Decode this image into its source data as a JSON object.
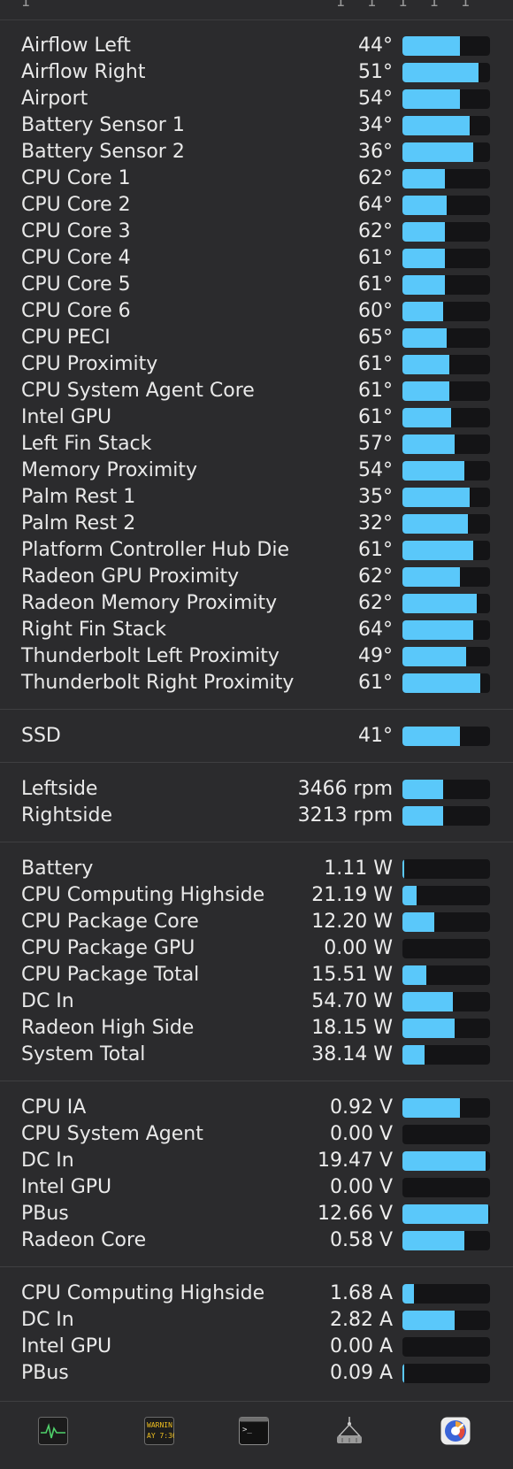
{
  "top": {
    "left_text": "1",
    "right_text": "1  1  1  1  1"
  },
  "temperatures": [
    {
      "name": "Airflow Left",
      "value": "44°",
      "level": 0.66
    },
    {
      "name": "Airflow Right",
      "value": "51°",
      "level": 0.87
    },
    {
      "name": "Airport",
      "value": "54°",
      "level": 0.66
    },
    {
      "name": "Battery Sensor 1",
      "value": "34°",
      "level": 0.77
    },
    {
      "name": "Battery Sensor 2",
      "value": "36°",
      "level": 0.81
    },
    {
      "name": "CPU Core 1",
      "value": "62°",
      "level": 0.48
    },
    {
      "name": "CPU Core 2",
      "value": "64°",
      "level": 0.5
    },
    {
      "name": "CPU Core 3",
      "value": "62°",
      "level": 0.48
    },
    {
      "name": "CPU Core 4",
      "value": "61°",
      "level": 0.48
    },
    {
      "name": "CPU Core 5",
      "value": "61°",
      "level": 0.48
    },
    {
      "name": "CPU Core 6",
      "value": "60°",
      "level": 0.46
    },
    {
      "name": "CPU PECI",
      "value": "65°",
      "level": 0.5
    },
    {
      "name": "CPU Proximity",
      "value": "61°",
      "level": 0.54
    },
    {
      "name": "CPU System Agent Core",
      "value": "61°",
      "level": 0.54
    },
    {
      "name": "Intel GPU",
      "value": "61°",
      "level": 0.56
    },
    {
      "name": "Left Fin Stack",
      "value": "57°",
      "level": 0.6
    },
    {
      "name": "Memory Proximity",
      "value": "54°",
      "level": 0.71
    },
    {
      "name": "Palm Rest 1",
      "value": "35°",
      "level": 0.77
    },
    {
      "name": "Palm Rest 2",
      "value": "32°",
      "level": 0.75
    },
    {
      "name": "Platform Controller Hub Die",
      "value": "61°",
      "level": 0.81
    },
    {
      "name": "Radeon GPU Proximity",
      "value": "62°",
      "level": 0.66
    },
    {
      "name": "Radeon Memory Proximity",
      "value": "62°",
      "level": 0.85
    },
    {
      "name": "Right Fin Stack",
      "value": "64°",
      "level": 0.81
    },
    {
      "name": "Thunderbolt Left Proximity",
      "value": "49°",
      "level": 0.73
    },
    {
      "name": "Thunderbolt Right Proximity",
      "value": "61°",
      "level": 0.89
    }
  ],
  "disks": [
    {
      "name": "SSD",
      "value": "41°",
      "level": 0.66
    }
  ],
  "fans": [
    {
      "name": "Leftside",
      "value": "3466 rpm",
      "level": 0.46
    },
    {
      "name": "Rightside",
      "value": "3213 rpm",
      "level": 0.46
    }
  ],
  "power": [
    {
      "name": "Battery",
      "value": "1.11 W",
      "level": 0.02
    },
    {
      "name": "CPU Computing Highside",
      "value": "21.19 W",
      "level": 0.16
    },
    {
      "name": "CPU Package Core",
      "value": "12.20 W",
      "level": 0.36
    },
    {
      "name": "CPU Package GPU",
      "value": "0.00 W",
      "level": 0.0
    },
    {
      "name": "CPU Package Total",
      "value": "15.51 W",
      "level": 0.27
    },
    {
      "name": "DC In",
      "value": "54.70 W",
      "level": 0.58
    },
    {
      "name": "Radeon High Side",
      "value": "18.15 W",
      "level": 0.6
    },
    {
      "name": "System Total",
      "value": "38.14 W",
      "level": 0.25
    }
  ],
  "voltage": [
    {
      "name": "CPU IA",
      "value": "0.92 V",
      "level": 0.66
    },
    {
      "name": "CPU System Agent",
      "value": "0.00 V",
      "level": 0.0
    },
    {
      "name": "DC In",
      "value": "19.47 V",
      "level": 0.95
    },
    {
      "name": "Intel GPU",
      "value": "0.00 V",
      "level": 0.0
    },
    {
      "name": "PBus",
      "value": "12.66 V",
      "level": 0.98
    },
    {
      "name": "Radeon Core",
      "value": "0.58 V",
      "level": 0.71
    }
  ],
  "current": [
    {
      "name": "CPU Computing Highside",
      "value": "1.68 A",
      "level": 0.13
    },
    {
      "name": "DC In",
      "value": "2.82 A",
      "level": 0.6
    },
    {
      "name": "Intel GPU",
      "value": "0.00 A",
      "level": 0.0
    },
    {
      "name": "PBus",
      "value": "0.09 A",
      "level": 0.02
    }
  ],
  "dock": {
    "console_text_1": "WARNIN",
    "console_text_2": "AY 7:36",
    "terminal_prompt": ">_",
    "icons": [
      "activity-monitor-icon",
      "console-icon",
      "terminal-icon",
      "system-information-icon",
      "istat-menus-icon"
    ]
  },
  "colors": {
    "bar_fill": "#5ac8fa",
    "bar_track": "#141416",
    "background": "#2b2b2d"
  }
}
